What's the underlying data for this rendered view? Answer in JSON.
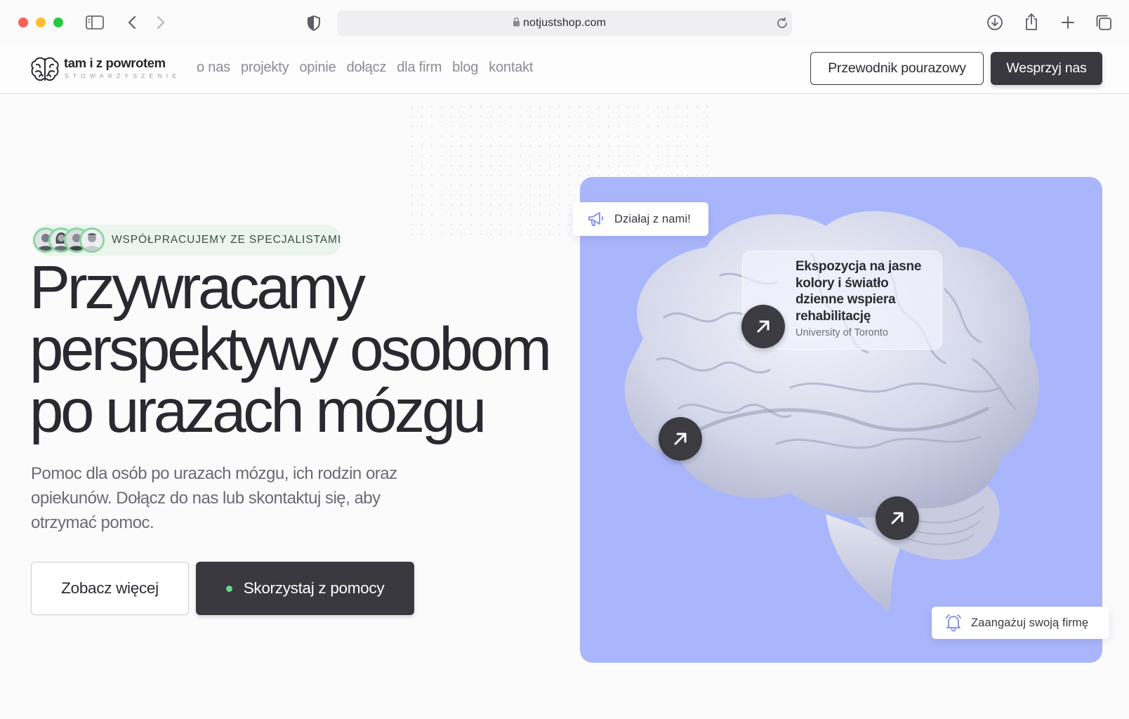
{
  "browser": {
    "url": "notjustshop.com"
  },
  "header": {
    "logo_title": "tam i z powrotem",
    "logo_subtitle": "STOWARZYSZENIE",
    "nav": [
      "o nas",
      "projekty",
      "opinie",
      "dołącz",
      "dla firm",
      "blog",
      "kontakt"
    ],
    "guide_button": "Przewodnik pourazowy",
    "support_button": "Wesprzyj nas"
  },
  "hero": {
    "badge_text": "WSPÓŁPRACUJEMY ZE SPECJALISTAMI",
    "headline_line1": "Przywracamy",
    "headline_line2": "perspektywy osobom",
    "headline_line3": "po urazach mózgu",
    "subtitle": "Pomoc dla osób po urazach mózgu, ich rodzin oraz opiekunów. Dołącz do nas lub skontaktuj się, aby otrzymać pomoc.",
    "more_button": "Zobacz więcej",
    "help_button": "Skorzystaj z pomocy"
  },
  "visual": {
    "act_tag": "Działaj z nami!",
    "firm_tag": "Zaangażuj swoją firmę",
    "info_card_title": "Ekspozycja na jasne kolory i światło dzienne wspiera rehabilitację",
    "info_card_source": "University of Toronto",
    "panel_color": "#aab6fb",
    "accent_green": "#63dc8c",
    "dark": "#38383e"
  }
}
